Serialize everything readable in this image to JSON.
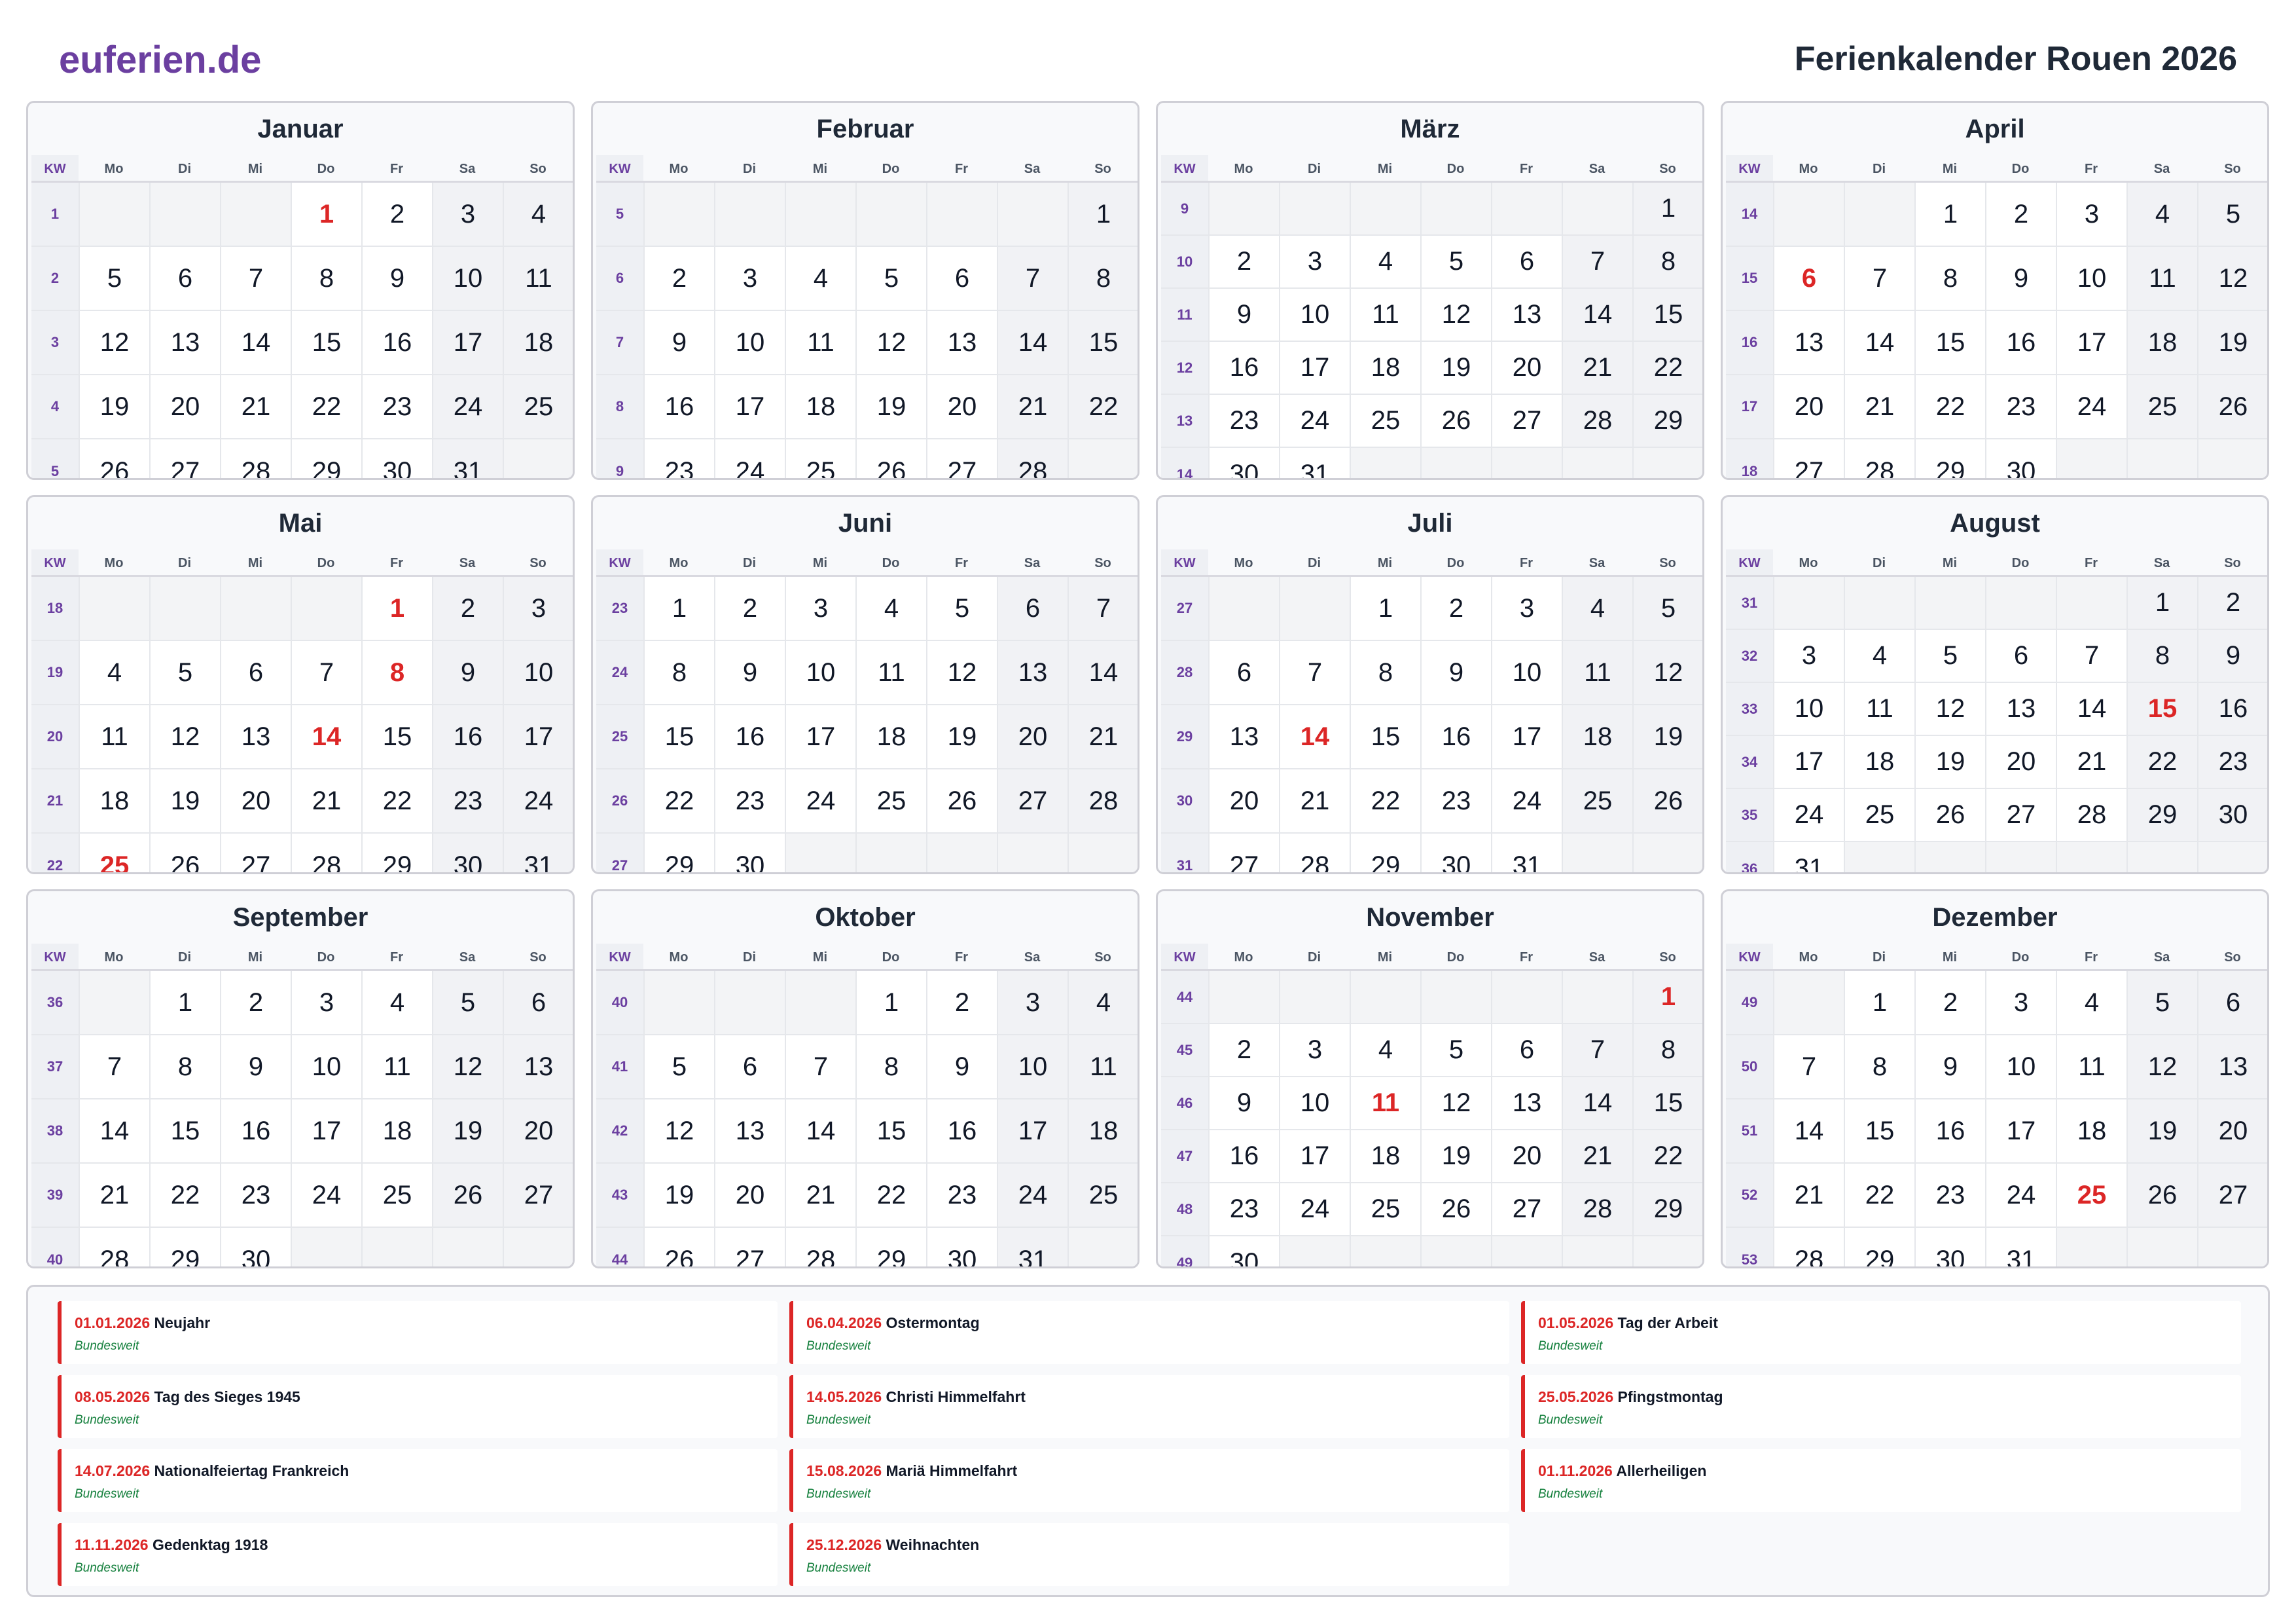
{
  "header": {
    "logo": "euferien.de",
    "title": "Ferienkalender Rouen 2026"
  },
  "weekday_labels": [
    "KW",
    "Mo",
    "Di",
    "Mi",
    "Do",
    "Fr",
    "Sa",
    "So"
  ],
  "months": [
    {
      "name": "Januar",
      "start": 3,
      "days": 31,
      "kw": [
        1,
        2,
        3,
        4,
        5
      ],
      "holidays": [
        1
      ]
    },
    {
      "name": "Februar",
      "start": 6,
      "days": 28,
      "kw": [
        5,
        6,
        7,
        8,
        9
      ],
      "holidays": []
    },
    {
      "name": "März",
      "start": 6,
      "days": 31,
      "kw": [
        9,
        10,
        11,
        12,
        13,
        14
      ],
      "holidays": []
    },
    {
      "name": "April",
      "start": 2,
      "days": 30,
      "kw": [
        14,
        15,
        16,
        17,
        18
      ],
      "holidays": [
        6
      ]
    },
    {
      "name": "Mai",
      "start": 4,
      "days": 31,
      "kw": [
        18,
        19,
        20,
        21,
        22
      ],
      "holidays": [
        1,
        8,
        14,
        25
      ]
    },
    {
      "name": "Juni",
      "start": 0,
      "days": 30,
      "kw": [
        23,
        24,
        25,
        26,
        27
      ],
      "holidays": []
    },
    {
      "name": "Juli",
      "start": 2,
      "days": 31,
      "kw": [
        27,
        28,
        29,
        30,
        31
      ],
      "holidays": [
        14
      ]
    },
    {
      "name": "August",
      "start": 5,
      "days": 31,
      "kw": [
        31,
        32,
        33,
        34,
        35,
        36
      ],
      "holidays": [
        15
      ]
    },
    {
      "name": "September",
      "start": 1,
      "days": 30,
      "kw": [
        36,
        37,
        38,
        39,
        40
      ],
      "holidays": []
    },
    {
      "name": "Oktober",
      "start": 3,
      "days": 31,
      "kw": [
        40,
        41,
        42,
        43,
        44
      ],
      "holidays": []
    },
    {
      "name": "November",
      "start": 6,
      "days": 30,
      "kw": [
        44,
        45,
        46,
        47,
        48,
        49
      ],
      "holidays": [
        1,
        11
      ]
    },
    {
      "name": "Dezember",
      "start": 1,
      "days": 31,
      "kw": [
        49,
        50,
        51,
        52,
        53
      ],
      "holidays": [
        25
      ]
    }
  ],
  "holiday_list": [
    {
      "date": "01.01.2026",
      "name": "Neujahr",
      "region": "Bundesweit"
    },
    {
      "date": "06.04.2026",
      "name": "Ostermontag",
      "region": "Bundesweit"
    },
    {
      "date": "01.05.2026",
      "name": "Tag der Arbeit",
      "region": "Bundesweit"
    },
    {
      "date": "08.05.2026",
      "name": "Tag des Sieges 1945",
      "region": "Bundesweit"
    },
    {
      "date": "14.05.2026",
      "name": "Christi Himmelfahrt",
      "region": "Bundesweit"
    },
    {
      "date": "25.05.2026",
      "name": "Pfingstmontag",
      "region": "Bundesweit"
    },
    {
      "date": "14.07.2026",
      "name": "Nationalfeiertag Frankreich",
      "region": "Bundesweit"
    },
    {
      "date": "15.08.2026",
      "name": "Mariä Himmelfahrt",
      "region": "Bundesweit"
    },
    {
      "date": "01.11.2026",
      "name": "Allerheiligen",
      "region": "Bundesweit"
    },
    {
      "date": "11.11.2026",
      "name": "Gedenktag 1918",
      "region": "Bundesweit"
    },
    {
      "date": "25.12.2026",
      "name": "Weihnachten",
      "region": "Bundesweit"
    }
  ],
  "colors": {
    "brand": "#6b3fa0",
    "holiday": "#dc2626",
    "region": "#15803d"
  }
}
